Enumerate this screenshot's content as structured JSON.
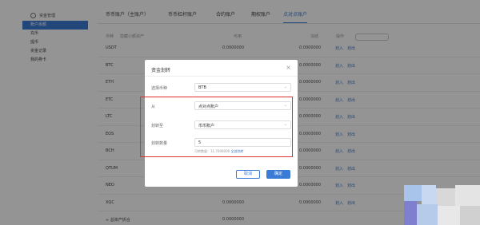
{
  "sidebar": {
    "header": "资金管理",
    "items": [
      {
        "label": "账户余额",
        "active": true
      },
      {
        "label": "充币",
        "active": false
      },
      {
        "label": "提币",
        "active": false
      },
      {
        "label": "资金记录",
        "active": false
      },
      {
        "label": "我的券卡",
        "active": false
      }
    ]
  },
  "tabs": [
    {
      "label": "币币账户（主账户）",
      "active": false
    },
    {
      "label": "币币杠杆账户",
      "active": false
    },
    {
      "label": "合约账户",
      "active": false
    },
    {
      "label": "期权账户",
      "active": false
    },
    {
      "label": "点对点账户",
      "active": true
    }
  ],
  "table": {
    "headers": {
      "coin": "币种",
      "hide_small": "隐藏小额资产",
      "available": "可用",
      "frozen": "冻结",
      "actions": "操作"
    },
    "rows": [
      {
        "coin": "USDT",
        "available": "0.0000000",
        "frozen": "0.0000000",
        "a1": "划入",
        "a2": "划出"
      },
      {
        "coin": "BTC",
        "available": "0.0000000",
        "frozen": "0.0000000",
        "a1": "划入",
        "a2": "划出"
      },
      {
        "coin": "ETH",
        "available": "0.0000000",
        "frozen": "0.0000000",
        "a1": "划入",
        "a2": "划出"
      },
      {
        "coin": "ETC",
        "available": "0.0000000",
        "frozen": "0.0000000",
        "a1": "划入",
        "a2": "划出"
      },
      {
        "coin": "LTC",
        "available": "0.0000000",
        "frozen": "0.0000000",
        "a1": "划入",
        "a2": "划出"
      },
      {
        "coin": "EOS",
        "available": "0.0000000",
        "frozen": "0.0000000",
        "a1": "划入",
        "a2": "划出"
      },
      {
        "coin": "BCH",
        "available": "0.0000000",
        "frozen": "0.0000000",
        "a1": "划入",
        "a2": "划出"
      },
      {
        "coin": "QTUM",
        "available": "0.0000000",
        "frozen": "0.0000000",
        "a1": "划入",
        "a2": "划出"
      },
      {
        "coin": "NEO",
        "available": "0.0000000",
        "frozen": "0.0000000",
        "a1": "划入",
        "a2": "划出"
      },
      {
        "coin": "XQC",
        "available": "0.0000000",
        "frozen": "0.0000000",
        "a1": "划入",
        "a2": "划出"
      },
      {
        "coin": "≈ 总资产折合",
        "available": "0.0000000",
        "frozen": "",
        "a1": "",
        "a2": ""
      }
    ]
  },
  "modal": {
    "title": "资金划转",
    "close": "×",
    "currency_label": "选择币种",
    "currency_value": "BTB",
    "from_label": "从",
    "from_value": "点对点账户",
    "to_label": "划转至",
    "to_value": "币币账户",
    "amount_label": "划转数量",
    "amount_value": "5",
    "hint": "可转数量：11.7000000",
    "hint_all": "全部划转",
    "cancel": "取消",
    "ok": "确定"
  },
  "colors": {
    "accent": "#3a7bd5",
    "highlight": "#e03030",
    "overlay": "rgba(0,0,0,0.42)"
  }
}
